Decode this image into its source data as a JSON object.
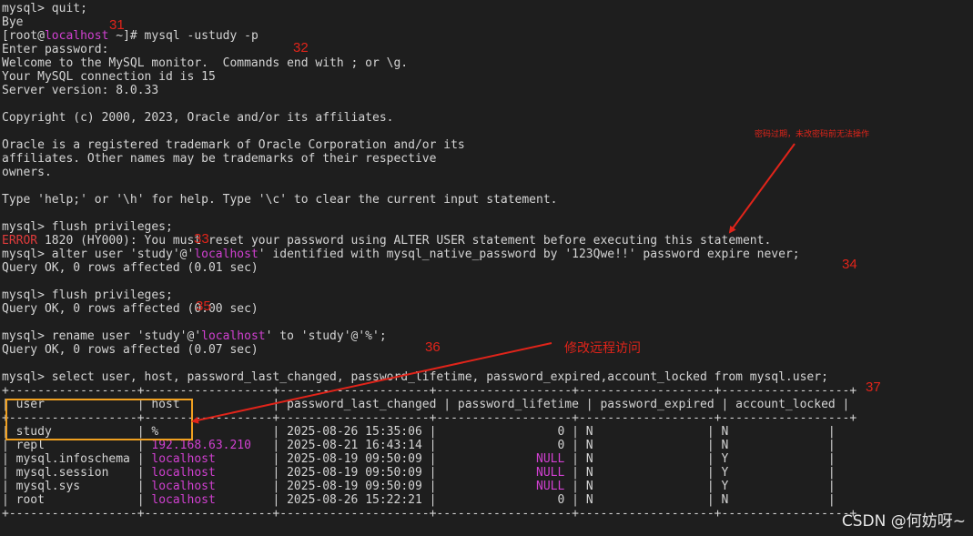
{
  "terminal": {
    "lines": [
      [
        {
          "t": "mysql> quit;",
          "c": "normal"
        }
      ],
      [
        {
          "t": "Bye",
          "c": "normal"
        }
      ],
      [
        {
          "t": "[root@",
          "c": "normal"
        },
        {
          "t": "localhost",
          "c": "magenta"
        },
        {
          "t": " ~]# mysql -ustudy -p",
          "c": "normal"
        }
      ],
      [
        {
          "t": "Enter password:",
          "c": "normal"
        }
      ],
      [
        {
          "t": "Welcome to the MySQL monitor.  Commands end with ; or \\g.",
          "c": "normal"
        }
      ],
      [
        {
          "t": "Your MySQL connection id is 15",
          "c": "normal"
        }
      ],
      [
        {
          "t": "Server version: 8.0.33",
          "c": "normal"
        }
      ],
      [],
      [
        {
          "t": "Copyright (c) 2000, 2023, Oracle and/or its affiliates.",
          "c": "normal"
        }
      ],
      [],
      [
        {
          "t": "Oracle is a registered trademark of Oracle Corporation and/or its",
          "c": "normal"
        }
      ],
      [
        {
          "t": "affiliates. Other names may be trademarks of their respective",
          "c": "normal"
        }
      ],
      [
        {
          "t": "owners.",
          "c": "normal"
        }
      ],
      [],
      [
        {
          "t": "Type 'help;' or '\\h' for help. Type '\\c' to clear the current input statement.",
          "c": "normal"
        }
      ],
      [],
      [
        {
          "t": "mysql> flush privileges;",
          "c": "normal"
        }
      ],
      [
        {
          "t": "ERROR",
          "c": "red"
        },
        {
          "t": " 1820 (HY000): You must reset your password using ALTER USER statement before executing this statement.",
          "c": "normal"
        }
      ],
      [
        {
          "t": "mysql> alter user 'study'@'",
          "c": "normal"
        },
        {
          "t": "localhost",
          "c": "magenta"
        },
        {
          "t": "' identified with mysql_native_password by '123Qwe!!' password expire never;",
          "c": "normal"
        }
      ],
      [
        {
          "t": "Query OK, 0 rows affected (0.01 sec)",
          "c": "normal"
        }
      ],
      [],
      [
        {
          "t": "mysql> flush privileges;",
          "c": "normal"
        }
      ],
      [
        {
          "t": "Query OK, 0 rows affected (0.00 sec)",
          "c": "normal"
        }
      ],
      [],
      [
        {
          "t": "mysql> rename user 'study'@'",
          "c": "normal"
        },
        {
          "t": "localhost",
          "c": "magenta"
        },
        {
          "t": "' to 'study'@'%';",
          "c": "normal"
        }
      ],
      [
        {
          "t": "Query OK, 0 rows affected (0.07 sec)",
          "c": "normal"
        }
      ],
      [],
      [
        {
          "t": "mysql> select user, host, password_last_changed, password_lifetime, password_expired,account_locked from mysql.user;",
          "c": "normal"
        }
      ],
      [
        {
          "t": "+------------------+------------------+---------------------+-------------------+-------------------+------------------+",
          "c": "normal"
        }
      ],
      [
        {
          "t": "| user             | host             | password_last_changed | password_lifetime | password_expired | account_locked |",
          "c": "normal"
        }
      ],
      [
        {
          "t": "+------------------+------------------+---------------------+-------------------+-------------------+------------------+",
          "c": "normal"
        }
      ],
      [
        {
          "t": "| study            | %                | 2025-08-26 15:35:06 |                 0 | N                | N              |",
          "c": "normal"
        }
      ],
      [
        {
          "t": "| repl             | ",
          "c": "normal"
        },
        {
          "t": "192.168.63.210",
          "c": "magenta"
        },
        {
          "t": "   | 2025-08-21 16:43:14 |                 0 | N                | N              |",
          "c": "normal"
        }
      ],
      [
        {
          "t": "| mysql.infoschema | ",
          "c": "normal"
        },
        {
          "t": "localhost",
          "c": "magenta"
        },
        {
          "t": "        | 2025-08-19 09:50:09 |              ",
          "c": "normal"
        },
        {
          "t": "NULL",
          "c": "magenta"
        },
        {
          "t": " | N                | Y              |",
          "c": "normal"
        }
      ],
      [
        {
          "t": "| mysql.session    | ",
          "c": "normal"
        },
        {
          "t": "localhost",
          "c": "magenta"
        },
        {
          "t": "        | 2025-08-19 09:50:09 |              ",
          "c": "normal"
        },
        {
          "t": "NULL",
          "c": "magenta"
        },
        {
          "t": " | N                | Y              |",
          "c": "normal"
        }
      ],
      [
        {
          "t": "| mysql.sys        | ",
          "c": "normal"
        },
        {
          "t": "localhost",
          "c": "magenta"
        },
        {
          "t": "        | 2025-08-19 09:50:09 |              ",
          "c": "normal"
        },
        {
          "t": "NULL",
          "c": "magenta"
        },
        {
          "t": " | N                | Y              |",
          "c": "normal"
        }
      ],
      [
        {
          "t": "| root             | ",
          "c": "normal"
        },
        {
          "t": "localhost",
          "c": "magenta"
        },
        {
          "t": "        | 2025-08-26 15:22:21 |                 0 | N                | N              |",
          "c": "normal"
        }
      ],
      [
        {
          "t": "+------------------+------------------+---------------------+-------------------+-------------------+------------------+",
          "c": "normal"
        }
      ]
    ]
  },
  "annotations": {
    "num_31": "31",
    "num_32": "32",
    "num_33": "33",
    "num_34": "34",
    "num_35": "35",
    "num_36": "36",
    "num_37": "37",
    "note_expired": "密码过期，未改密码前无法操作",
    "note_remote": "修改远程访问"
  },
  "watermark": "CSDN @何妨呀~",
  "colors": {
    "background": "#1e1e1e",
    "text": "#d4d4d4",
    "magenta": "#d040d0",
    "error": "#e03b3b",
    "annotation": "#e0241a",
    "highlight": "#f0a020"
  }
}
